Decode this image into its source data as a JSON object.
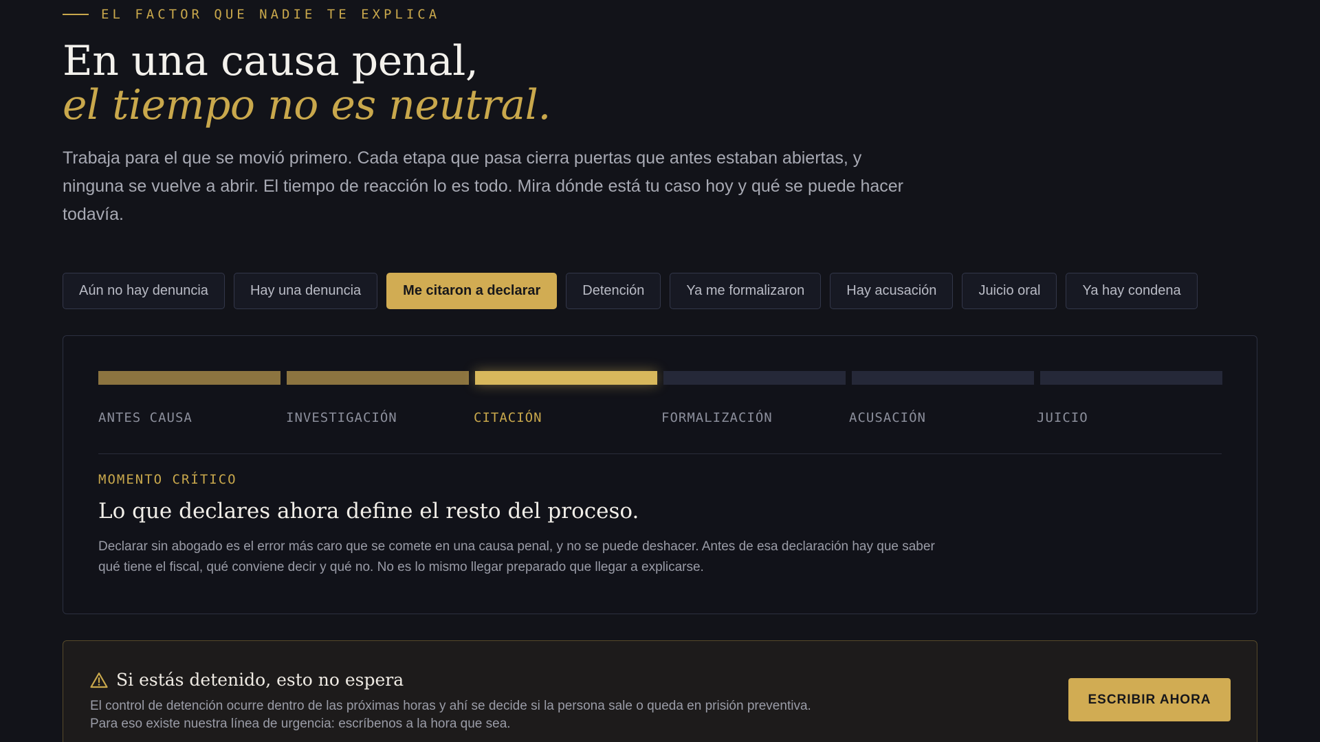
{
  "eyebrow": "EL FACTOR QUE NADIE TE EXPLICA",
  "headline": {
    "line1": "En una causa penal,",
    "line2": "el tiempo no es neutral."
  },
  "intro": "Trabaja para el que se movió primero. Cada etapa que pasa cierra puertas que antes estaban abiertas, y ninguna se vuelve a abrir. El tiempo de reacción lo es todo. Mira dónde está tu caso hoy y qué se puede hacer todavía.",
  "chips": [
    {
      "label": "Aún no hay denuncia",
      "active": false
    },
    {
      "label": "Hay una denuncia",
      "active": false
    },
    {
      "label": "Me citaron a declarar",
      "active": true
    },
    {
      "label": "Detención",
      "active": false
    },
    {
      "label": "Ya me formalizaron",
      "active": false
    },
    {
      "label": "Hay acusación",
      "active": false
    },
    {
      "label": "Juicio oral",
      "active": false
    },
    {
      "label": "Ya hay condena",
      "active": false
    }
  ],
  "timeline": {
    "stages": [
      "ANTES CAUSA",
      "INVESTIGACIÓN",
      "CITACIÓN",
      "FORMALIZACIÓN",
      "ACUSACIÓN",
      "JUICIO"
    ],
    "current_index": 2,
    "colors": {
      "done": "#8c7440",
      "current": "#d8b85c",
      "pending": "#252838"
    }
  },
  "moment": {
    "tag": "MOMENTO CRÍTICO",
    "title": "Lo que declares ahora define el resto del proceso.",
    "body": "Declarar sin abogado es el error más caro que se comete en una causa penal, y no se puede deshacer. Antes de esa declaración hay que saber qué tiene el fiscal, qué conviene decir y qué no. No es lo mismo llegar preparado que llegar a explicarse."
  },
  "urgent": {
    "icon": "warning-triangle-icon",
    "title": "Si estás detenido, esto no espera",
    "body": "El control de detención ocurre dentro de las próximas horas y ahí se decide si la persona sale o queda en prisión preventiva. Para eso existe nuestra línea de urgencia: escríbenos a la hora que sea.",
    "cta": "ESCRIBIR AHORA"
  },
  "accent_color": "#c9a84c"
}
